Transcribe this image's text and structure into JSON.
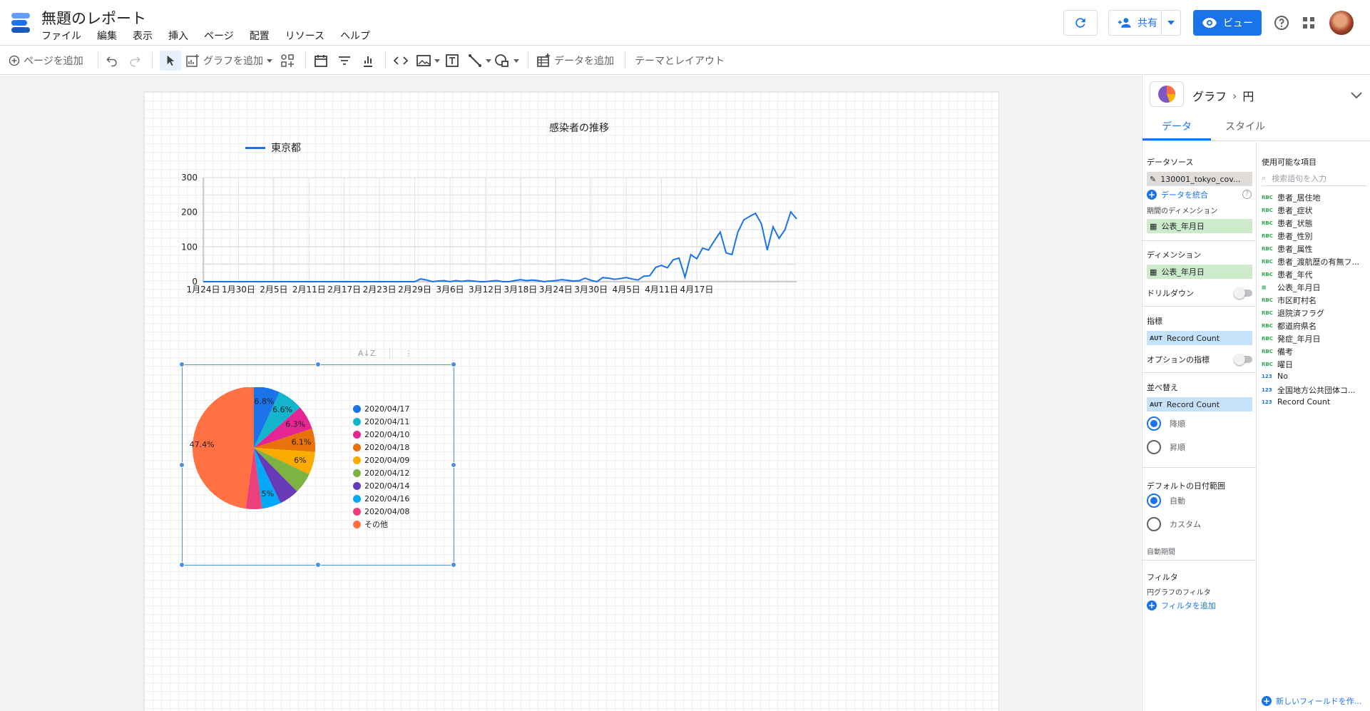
{
  "app": {
    "title": "無題のレポート",
    "menu": [
      "ファイル",
      "編集",
      "表示",
      "挿入",
      "ページ",
      "配置",
      "リソース",
      "ヘルプ"
    ],
    "share_label": "共有",
    "view_label": "ビュー"
  },
  "toolbar": {
    "add_page": "ページを追加",
    "add_chart": "グラフを追加",
    "add_data": "データを追加",
    "theme_layout": "テーマとレイアウト"
  },
  "line_chart": {
    "title": "感染者の推移",
    "legend": "東京都",
    "line_color": "#1a73e8"
  },
  "pie_chart": {
    "legend": [
      {
        "label": "2020/04/17",
        "color": "#1a73e8"
      },
      {
        "label": "2020/04/11",
        "color": "#12b5cb"
      },
      {
        "label": "2020/04/10",
        "color": "#e52592"
      },
      {
        "label": "2020/04/18",
        "color": "#e8710a"
      },
      {
        "label": "2020/04/09",
        "color": "#f9ab00"
      },
      {
        "label": "2020/04/12",
        "color": "#7cb342"
      },
      {
        "label": "2020/04/14",
        "color": "#673ab7"
      },
      {
        "label": "2020/04/16",
        "color": "#03a9f4"
      },
      {
        "label": "2020/04/08",
        "color": "#ec407a"
      },
      {
        "label": "その他",
        "color": "#ff7043"
      }
    ],
    "slice_labels": [
      "6.8%",
      "6.6%",
      "6.3%",
      "6.1%",
      "6%",
      "5%",
      "47.4%"
    ]
  },
  "chart_data": [
    {
      "type": "line",
      "title": "感染者の推移",
      "series": [
        {
          "name": "東京都",
          "values": [
            0,
            0,
            0,
            0,
            0,
            0,
            0,
            0,
            0,
            0,
            0,
            0,
            0,
            0,
            0,
            0,
            0,
            0,
            0,
            0,
            0,
            0,
            0,
            0,
            0,
            0,
            0,
            0,
            0,
            0,
            0,
            0,
            0,
            0,
            0,
            0,
            0,
            8,
            5,
            0,
            2,
            3,
            0,
            3,
            1,
            3,
            2,
            0,
            0,
            2,
            3,
            0,
            0,
            3,
            6,
            3,
            5,
            3,
            0,
            2,
            3,
            6,
            4,
            2,
            3,
            10,
            4,
            0,
            12,
            10,
            7,
            9,
            12,
            8,
            5,
            16,
            17,
            41,
            47,
            40,
            63,
            68,
            13,
            78,
            66,
            97,
            91,
            118,
            143,
            83,
            78,
            143,
            178,
            188,
            197,
            167,
            91,
            158,
            125,
            149,
            201,
            181
          ]
        }
      ],
      "x_start": "2020-01-24",
      "x_ticks": [
        "1月24日",
        "1月30日",
        "2月5日",
        "2月11日",
        "2月17日",
        "2月23日",
        "2月29日",
        "3月6日",
        "3月12日",
        "3月18日",
        "3月24日",
        "3月30日",
        "4月5日",
        "4月11日",
        "4月17日"
      ],
      "y_ticks": [
        0,
        100,
        200,
        300
      ],
      "ylim": [
        0,
        300
      ],
      "grid": true,
      "legend": "top-left"
    },
    {
      "type": "pie",
      "categories": [
        "2020/04/17",
        "2020/04/11",
        "2020/04/10",
        "2020/04/18",
        "2020/04/09",
        "2020/04/12",
        "2020/04/14",
        "2020/04/16",
        "2020/04/08",
        "その他"
      ],
      "values": [
        6.8,
        6.6,
        6.3,
        6.1,
        6.0,
        5.4,
        5.2,
        5.0,
        4.2,
        47.4
      ],
      "legend": "right"
    }
  ],
  "panel": {
    "crumb_parent": "グラフ",
    "crumb_child": "円",
    "tab_data": "データ",
    "tab_style": "スタイル",
    "data_source_label": "データソース",
    "data_source_value": "130001_tokyo_cov...",
    "blend_label": "データを統合",
    "period_dim_label": "期間のディメンション",
    "period_dim_value": "公表_年月日",
    "dimension_label": "ディメンション",
    "dimension_value": "公表_年月日",
    "drilldown_label": "ドリルダウン",
    "metric_label": "指標",
    "metric_value": "Record Count",
    "metric_badge": "AUT",
    "optional_metric_label": "オプションの指標",
    "sort_label": "並べ替え",
    "sort_value": "Record Count",
    "sort_desc": "降順",
    "sort_asc": "昇順",
    "date_range_label": "デフォルトの日付範囲",
    "date_auto": "自動",
    "date_custom": "カスタム",
    "auto_period": "自動期間",
    "filter_label": "フィルタ",
    "pie_filter_label": "円グラフのフィルタ",
    "add_filter": "フィルタを追加",
    "available_label": "使用可能な項目",
    "search_placeholder": "検索語句を入力",
    "fields": [
      {
        "type": "RBC",
        "name": "患者_居住地"
      },
      {
        "type": "RBC",
        "name": "患者_症状"
      },
      {
        "type": "RBC",
        "name": "患者_状態"
      },
      {
        "type": "RBC",
        "name": "患者_性別"
      },
      {
        "type": "RBC",
        "name": "患者_属性"
      },
      {
        "type": "RBC",
        "name": "患者_渡航歴の有無フ..."
      },
      {
        "type": "RBC",
        "name": "患者_年代"
      },
      {
        "type": "date",
        "name": "公表_年月日"
      },
      {
        "type": "RBC",
        "name": "市区町村名"
      },
      {
        "type": "RBC",
        "name": "退院済フラグ"
      },
      {
        "type": "RBC",
        "name": "都道府県名"
      },
      {
        "type": "RBC",
        "name": "発症_年月日"
      },
      {
        "type": "RBC",
        "name": "備考"
      },
      {
        "type": "RBC",
        "name": "曜日"
      },
      {
        "type": "123",
        "name": "No"
      },
      {
        "type": "123",
        "name": "全国地方公共団体コ..."
      },
      {
        "type": "123",
        "name": "Record Count"
      }
    ],
    "new_field": "新しいフィールドを作..."
  }
}
